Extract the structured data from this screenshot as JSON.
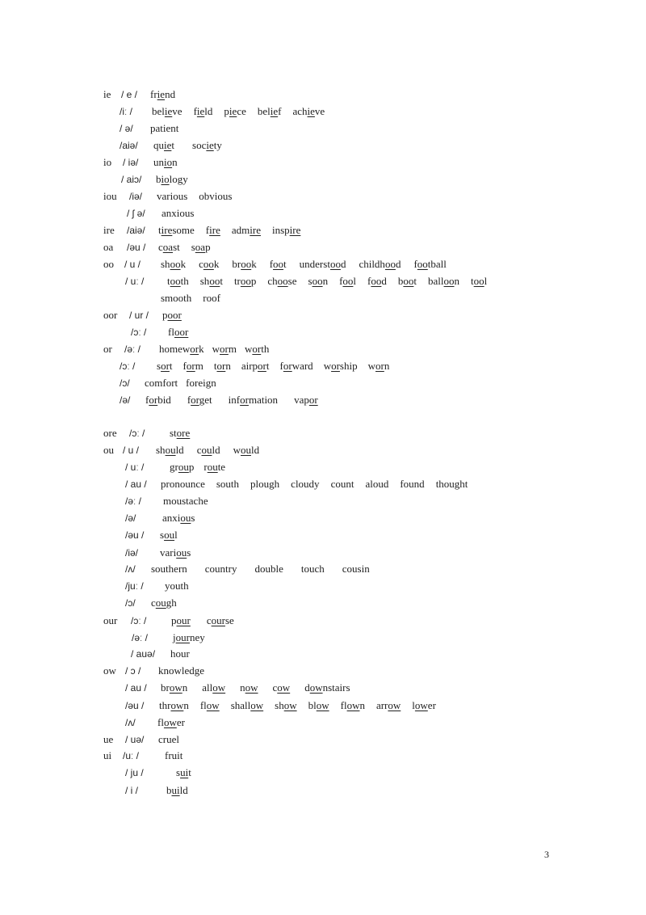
{
  "lines": [
    {
      "key": "ie",
      "phon": "/ e /",
      "words": [
        [
          "fr",
          "ie",
          "nd"
        ]
      ]
    },
    {
      "key": "",
      "phon": "/iː /",
      "words": [
        [
          "bel",
          "ie",
          "ve"
        ],
        [
          "f",
          "ie",
          "ld"
        ],
        [
          "p",
          "ie",
          "ce"
        ],
        [
          "bel",
          "ie",
          "f"
        ],
        [
          "ach",
          "ie",
          "ve"
        ]
      ]
    },
    {
      "key": "",
      "phon": "/ ə/",
      "words": [
        [
          "patient"
        ]
      ]
    },
    {
      "key": "",
      "phon": "/aiə/",
      "words": [
        [
          "qu",
          "ie",
          "t"
        ],
        [
          "soc",
          "ie",
          "ty"
        ]
      ]
    },
    {
      "key": "io",
      "phon": "/ iə/",
      "words": [
        [
          "un",
          "io",
          "n"
        ]
      ]
    },
    {
      "key": "",
      "phon": "/ aiɔ/",
      "words": [
        [
          "b",
          "io",
          "logy"
        ]
      ]
    },
    {
      "key": "iou",
      "phon": "/iə/",
      "words": [
        [
          "various"
        ],
        [
          "obvious"
        ]
      ]
    },
    {
      "key": "",
      "phon": "/ ʃ ə/",
      "words": [
        [
          "anxious"
        ]
      ]
    },
    {
      "key": "ire",
      "phon": "/aiə/",
      "words": [
        [
          "t",
          "ire",
          "some"
        ],
        [
          "f",
          "ire",
          ""
        ],
        [
          "adm",
          "ire",
          ""
        ],
        [
          "insp",
          "ire",
          ""
        ]
      ]
    },
    {
      "key": "oa",
      "phon": "/əu /",
      "words": [
        [
          "c",
          "oa",
          "st"
        ],
        [
          "s",
          "oa",
          "p"
        ]
      ]
    },
    {
      "key": "oo",
      "phon": "/ u /",
      "words": [
        [
          "sh",
          "oo",
          "k"
        ],
        [
          "c",
          "oo",
          "k"
        ],
        [
          "br",
          "oo",
          "k"
        ],
        [
          "f",
          "oo",
          "t"
        ],
        [
          "underst",
          "oo",
          "d"
        ],
        [
          "childh",
          "oo",
          "d"
        ],
        [
          "f",
          "oo",
          "tball"
        ]
      ]
    },
    {
      "key": "",
      "phon": "/ uː /",
      "words": [
        [
          "t",
          "oo",
          "th"
        ],
        [
          "sh",
          "oo",
          "t"
        ],
        [
          "tr",
          "oo",
          "p"
        ],
        [
          "ch",
          "oo",
          "se"
        ],
        [
          "s",
          "oo",
          "n"
        ],
        [
          "f",
          "oo",
          "l"
        ],
        [
          "f",
          "oo",
          "d"
        ],
        [
          "b",
          "oo",
          "t"
        ],
        [
          "ball",
          "oo",
          "n"
        ],
        [
          "t",
          "oo",
          "l"
        ]
      ]
    },
    {
      "key": "",
      "phon": "",
      "words": [
        [
          "smooth"
        ],
        [
          "roof"
        ]
      ]
    },
    {
      "key": "oor",
      "phon": "/ ur /",
      "words": [
        [
          "p",
          "oor",
          ""
        ]
      ]
    },
    {
      "key": "",
      "phon": "/ɔː /",
      "words": [
        [
          "fl",
          "oor",
          ""
        ]
      ]
    },
    {
      "key": "or",
      "phon": "/əː /",
      "words": [
        [
          "homew",
          "or",
          "k"
        ],
        [
          "w",
          "or",
          "m"
        ],
        [
          "w",
          "or",
          "th"
        ]
      ]
    },
    {
      "key": "",
      "phon": "/ɔː /",
      "words": [
        [
          "s",
          "or",
          "t"
        ],
        [
          "f",
          "or",
          "m"
        ],
        [
          "t",
          "or",
          "n"
        ],
        [
          "airp",
          "or",
          "t"
        ],
        [
          "f",
          "or",
          "ward"
        ],
        [
          "w",
          "or",
          "ship"
        ],
        [
          "w",
          "or",
          "n"
        ]
      ]
    },
    {
      "key": "",
      "phon": "/ɔ/",
      "words": [
        [
          "comfort"
        ],
        [
          "foreign"
        ]
      ]
    },
    {
      "key": "",
      "phon": "/ə/",
      "words": [
        [
          "f",
          "or",
          "bid"
        ],
        [
          "f",
          "or",
          "get"
        ],
        [
          "inf",
          "or",
          "mation"
        ],
        [
          "vap",
          "or",
          ""
        ]
      ]
    },
    {
      "key": "ore",
      "phon": "/ɔː /",
      "words": [
        [
          "st",
          "ore",
          ""
        ]
      ]
    },
    {
      "key": "ou",
      "phon": "/ u /",
      "words": [
        [
          "sh",
          "ou",
          "ld"
        ],
        [
          "c",
          "ou",
          "ld"
        ],
        [
          "w",
          "ou",
          "ld"
        ]
      ]
    },
    {
      "key": "",
      "phon": "/ uː /",
      "words": [
        [
          "gr",
          "ou",
          "p"
        ],
        [
          "r",
          "ou",
          "te"
        ]
      ]
    },
    {
      "key": "",
      "phon": "/ au /",
      "words": [
        [
          "pronounce"
        ],
        [
          "south"
        ],
        [
          "plough"
        ],
        [
          "cloudy"
        ],
        [
          "count"
        ],
        [
          "aloud"
        ],
        [
          "found"
        ],
        [
          "thought"
        ]
      ]
    },
    {
      "key": "",
      "phon": "/əː /",
      "words": [
        [
          "moustache"
        ]
      ]
    },
    {
      "key": "",
      "phon": "/ə/",
      "words": [
        [
          "anxi",
          "ou",
          "s"
        ]
      ]
    },
    {
      "key": "",
      "phon": "/əu /",
      "words": [
        [
          "s",
          "ou",
          "l"
        ]
      ]
    },
    {
      "key": "",
      "phon": "/iə/",
      "words": [
        [
          "vari",
          "ou",
          "s"
        ]
      ]
    },
    {
      "key": "",
      "phon": "/ʌ/",
      "words": [
        [
          "southern"
        ],
        [
          "country"
        ],
        [
          "double"
        ],
        [
          "touch"
        ],
        [
          "cousin"
        ]
      ]
    },
    {
      "key": "",
      "phon": "/juː /",
      "words": [
        [
          "youth"
        ]
      ]
    },
    {
      "key": "",
      "phon": "/ɔ/",
      "words": [
        [
          "c",
          "ou",
          "gh"
        ]
      ]
    },
    {
      "key": "our",
      "phon": "/ɔː /",
      "words": [
        [
          "p",
          "our",
          ""
        ],
        [
          "c",
          "our",
          "se"
        ]
      ]
    },
    {
      "key": "",
      "phon": "/əː /",
      "words": [
        [
          "j",
          "our",
          "ney"
        ]
      ]
    },
    {
      "key": "",
      "phon": "/ auə/",
      "words": [
        [
          "hour"
        ]
      ]
    },
    {
      "key": "ow",
      "phon": "/ ɔ /",
      "words": [
        [
          "knowledge"
        ]
      ]
    },
    {
      "key": "",
      "phon": "/ au /",
      "words": [
        [
          "br",
          "ow",
          "n"
        ],
        [
          "all",
          "ow",
          ""
        ],
        [
          "n",
          "ow",
          ""
        ],
        [
          "c",
          "ow",
          ""
        ],
        [
          "d",
          "ow",
          "nstairs"
        ]
      ]
    },
    {
      "key": "",
      "phon": "/əu /",
      "words": [
        [
          "thr",
          "ow",
          "n"
        ],
        [
          "fl",
          "ow",
          ""
        ],
        [
          "shall",
          "ow",
          ""
        ],
        [
          "sh",
          "ow",
          ""
        ],
        [
          "bl",
          "ow",
          ""
        ],
        [
          "fl",
          "ow",
          "n"
        ],
        [
          "arr",
          "ow",
          ""
        ],
        [
          "l",
          "ow",
          "er"
        ]
      ]
    },
    {
      "key": "",
      "phon": "/ʌ/",
      "words": [
        [
          "fl",
          "ow",
          "er"
        ]
      ]
    },
    {
      "key": "ue",
      "phon": "/ uə/",
      "words": [
        [
          "cruel"
        ]
      ]
    },
    {
      "key": "ui",
      "phon": "/uː /",
      "words": [
        [
          "fruit"
        ]
      ]
    },
    {
      "key": "",
      "phon": "/ ju /",
      "words": [
        [
          "s",
          "ui",
          "t"
        ]
      ]
    },
    {
      "key": "",
      "phon": "/ i /",
      "words": [
        [
          "b",
          "ui",
          "ld"
        ]
      ]
    }
  ],
  "page_number": "3"
}
